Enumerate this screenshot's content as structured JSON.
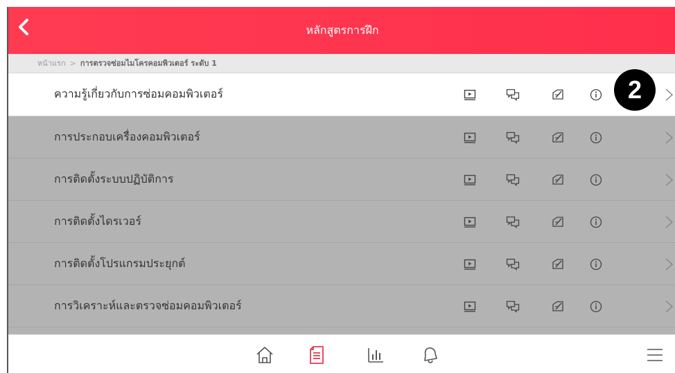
{
  "header": {
    "title": "หลักสูตรการฝึก",
    "back_icon": "chevron-left-icon"
  },
  "breadcrumb": {
    "home": "หน้าแรก",
    "separator": ">",
    "current": "การตรวจซ่อมไมโครคอมพิวเตอร์ ระดับ 1"
  },
  "badge": {
    "number": "2"
  },
  "courses": [
    {
      "label": "ความรู้เกี่ยวกับการซ่อมคอมพิวเตอร์"
    },
    {
      "label": "การประกอบเครื่องคอมพิวเตอร์"
    },
    {
      "label": "การติดตั้งระบบปฏิบัติการ"
    },
    {
      "label": "การติดตั้งไดรเวอร์"
    },
    {
      "label": "การติดตั้งโปรแกรมประยุกต์"
    },
    {
      "label": "การวิเคราะห์และตรวจซ่อมคอมพิวเตอร์"
    }
  ],
  "row_icons": [
    "video-icon",
    "chat-icon",
    "write-icon",
    "info-icon",
    "chevron-right-icon"
  ],
  "tabbar": {
    "items": [
      "home-icon",
      "document-icon",
      "chart-icon",
      "bell-icon",
      "menu-icon"
    ],
    "active": "document-icon"
  },
  "colors": {
    "header": "#ff3b52",
    "accent": "#e8384f",
    "overlay": "#b3b3b3"
  }
}
